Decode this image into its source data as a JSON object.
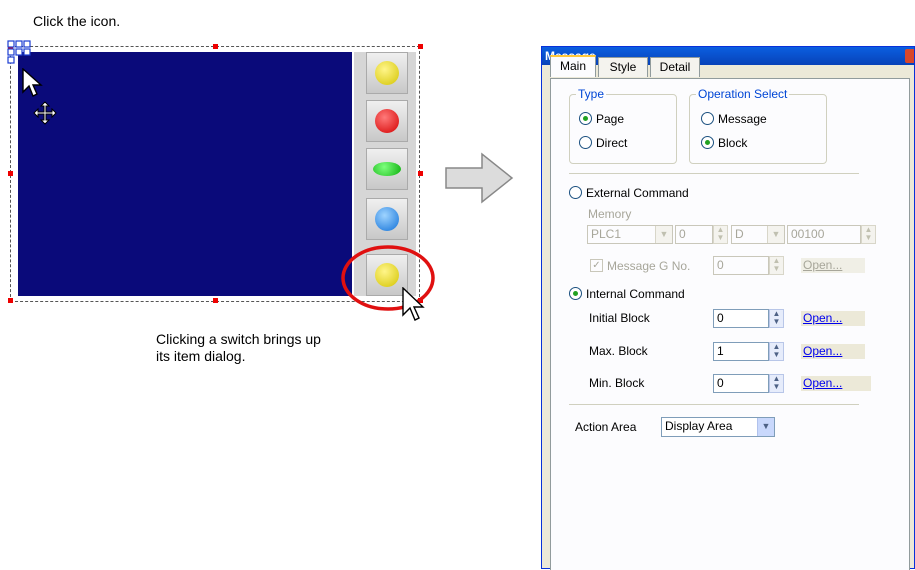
{
  "left": {
    "caption_top": "Click the icon.",
    "caption_bottom_line1": "Clicking a switch brings up",
    "caption_bottom_line2": "its item dialog."
  },
  "colors": {
    "screen_blue": "#0a0a7a",
    "highlight_red": "#e01010",
    "xp_title_blue": "#0842b8"
  },
  "dialog": {
    "title": "Message",
    "tabs": [
      "Main",
      "Style",
      "Detail"
    ],
    "type_group": {
      "legend": "Type",
      "options": [
        "Page",
        "Direct"
      ],
      "selected": "Page"
    },
    "operation_group": {
      "legend": "Operation Select",
      "options": [
        "Message",
        "Block"
      ],
      "selected": "Block"
    },
    "external_command": {
      "label": "External Command",
      "memory_label": "Memory",
      "plc_value": "PLC1",
      "num_value": "0",
      "device_value": "D",
      "address_value": "00100",
      "message_g_label": "Message G No.",
      "message_g_value": "0",
      "open_label": "Open..."
    },
    "internal_command": {
      "label": "Internal Command",
      "initial_block_label": "Initial Block",
      "initial_block_value": "0",
      "max_block_label": "Max. Block",
      "max_block_value": "1",
      "min_block_label": "Min. Block",
      "min_block_value": "0",
      "open_label": "Open..."
    },
    "action_area": {
      "label": "Action Area",
      "value": "Display Area"
    }
  }
}
